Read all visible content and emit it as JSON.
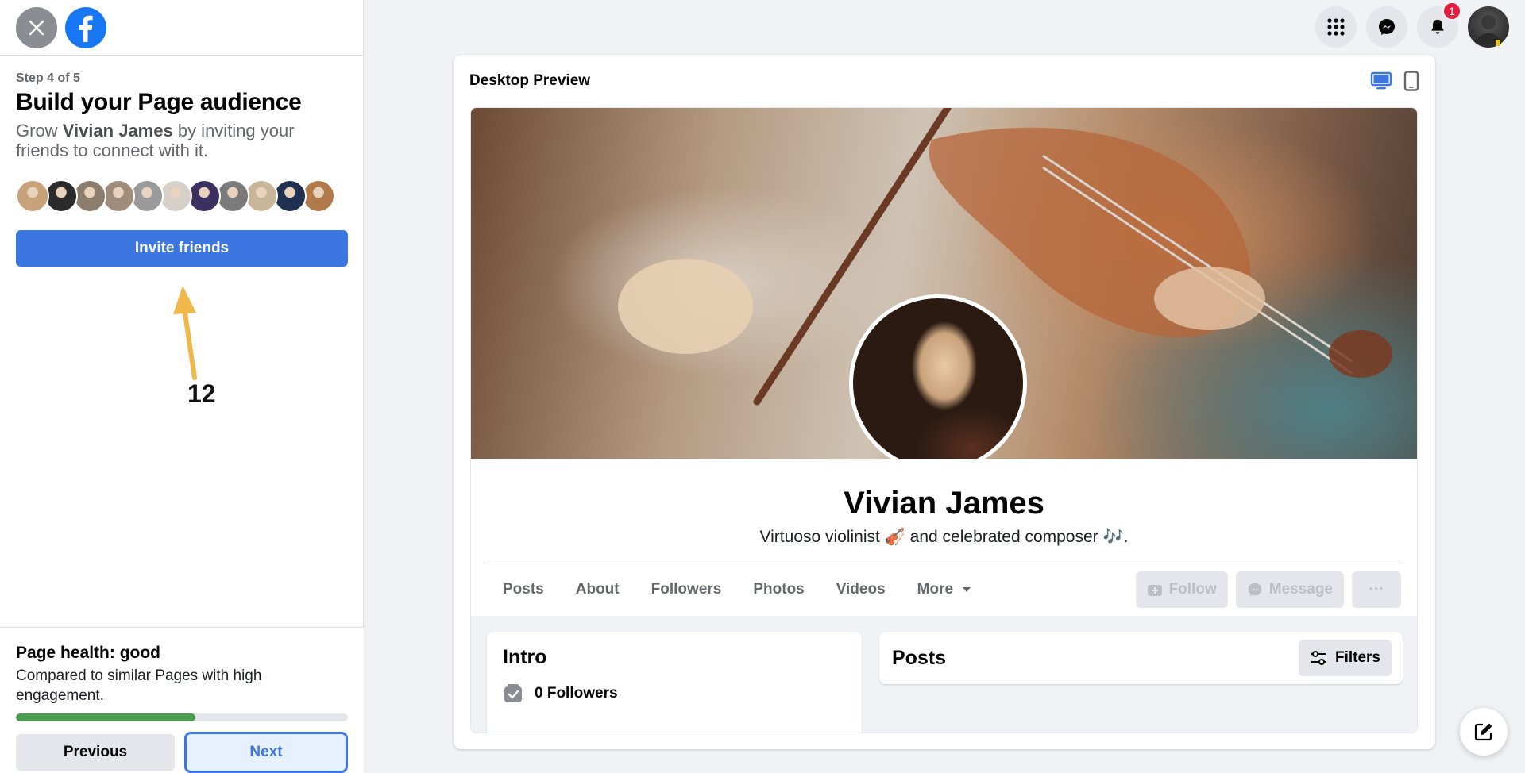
{
  "step": {
    "label": "Step 4 of 5",
    "title": "Build your Page audience",
    "desc_prefix": "Grow ",
    "desc_name": "Vivian James",
    "desc_suffix": " by inviting your friends to connect with it."
  },
  "invite_button": "Invite friends",
  "annotation_number": "12",
  "friend_avatar_colors": [
    "#c8a27a",
    "#2b2b2b",
    "#8d7d6e",
    "#a08c7a",
    "#9a9a9a",
    "#d6d0c8",
    "#3b3060",
    "#7a7a7a",
    "#c9b59a",
    "#203050",
    "#b07a4a"
  ],
  "health": {
    "title": "Page health: good",
    "desc": "Compared to similar Pages with high engagement.",
    "progress_percent": 54
  },
  "nav_buttons": {
    "previous": "Previous",
    "next": "Next"
  },
  "topbar": {
    "notification_count": "1"
  },
  "preview": {
    "title": "Desktop Preview",
    "page_name": "Vivian James",
    "bio": "Virtuoso violinist 🎻 and celebrated composer 🎶.",
    "tabs": [
      "Posts",
      "About",
      "Followers",
      "Photos",
      "Videos",
      "More"
    ],
    "actions": {
      "follow": "Follow",
      "message": "Message",
      "more": "···"
    },
    "intro_title": "Intro",
    "followers_text": "0 Followers",
    "posts_title": "Posts",
    "filters_label": "Filters"
  },
  "colors": {
    "primary": "#3b76e1",
    "health_good": "#4a9c4f",
    "badge": "#e41e3f"
  }
}
